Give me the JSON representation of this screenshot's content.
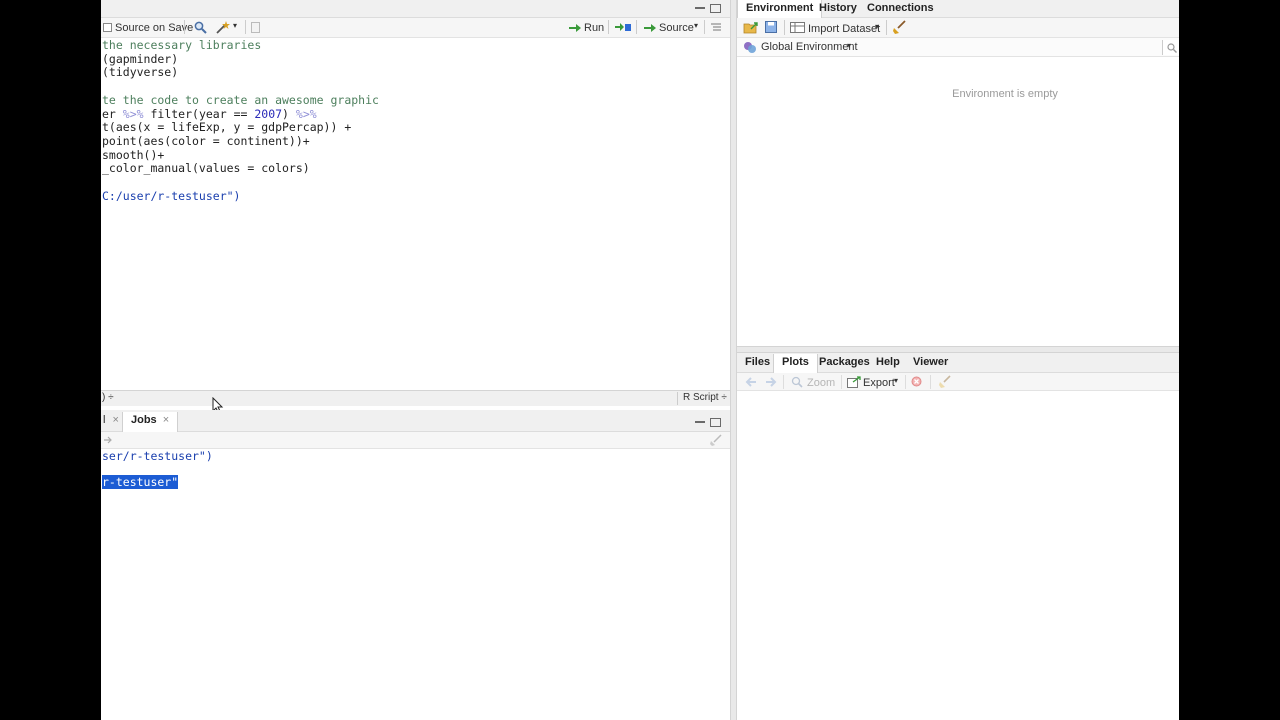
{
  "editor": {
    "toolbar": {
      "source_on_save": "Source on Save",
      "run": "Run",
      "source": "Source"
    },
    "code_lines": [
      {
        "parts": [
          {
            "t": "the necessary libraries",
            "c": "c-comment"
          }
        ]
      },
      {
        "parts": [
          {
            "t": "(gapminder)",
            "c": ""
          }
        ]
      },
      {
        "parts": [
          {
            "t": "(tidyverse)",
            "c": ""
          }
        ]
      },
      {
        "parts": [
          {
            "t": "",
            "c": ""
          }
        ]
      },
      {
        "parts": [
          {
            "t": "te the code to create an awesome graphic",
            "c": "c-comment"
          }
        ]
      },
      {
        "parts": [
          {
            "t": "er ",
            "c": ""
          },
          {
            "t": "%>%",
            "c": "c-op"
          },
          {
            "t": " filter(year == ",
            "c": ""
          },
          {
            "t": "2007",
            "c": "c-num"
          },
          {
            "t": ") ",
            "c": ""
          },
          {
            "t": "%>%",
            "c": "c-op"
          }
        ]
      },
      {
        "parts": [
          {
            "t": "t(aes(x = lifeExp, y = gdpPercap)) +",
            "c": ""
          }
        ]
      },
      {
        "parts": [
          {
            "t": "point(aes(color = continent))+",
            "c": ""
          }
        ]
      },
      {
        "parts": [
          {
            "t": "smooth()+",
            "c": ""
          }
        ]
      },
      {
        "parts": [
          {
            "t": "_color_manual(values = colors)",
            "c": ""
          }
        ]
      },
      {
        "parts": [
          {
            "t": "",
            "c": ""
          }
        ]
      },
      {
        "parts": [
          {
            "t": "C:/user/r-testuser\")",
            "c": "c-str"
          }
        ]
      }
    ],
    "status_left": ") ÷",
    "status_right": "R Script ÷"
  },
  "console": {
    "tabs": [
      {
        "label": "l",
        "closable": true
      },
      {
        "label": "Jobs",
        "closable": true
      }
    ],
    "lines": [
      {
        "text": "ser/r-testuser\")",
        "selected": false
      },
      {
        "text": "",
        "selected": false
      },
      {
        "text": "r-testuser\"",
        "selected": true
      }
    ]
  },
  "environment": {
    "tabs": [
      "Environment",
      "History",
      "Connections"
    ],
    "active_tab": "Environment",
    "import_dataset": "Import Dataset",
    "scope": "Global Environment",
    "empty_message": "Environment is empty"
  },
  "files": {
    "tabs": [
      "Files",
      "Plots",
      "Packages",
      "Help",
      "Viewer"
    ],
    "active_tab": "Plots",
    "zoom": "Zoom",
    "export": "Export"
  },
  "icons": {
    "accent_green": "#3a9a3a",
    "accent_blue": "#2d6bd6",
    "selection_blue": "#1c5cd4"
  }
}
